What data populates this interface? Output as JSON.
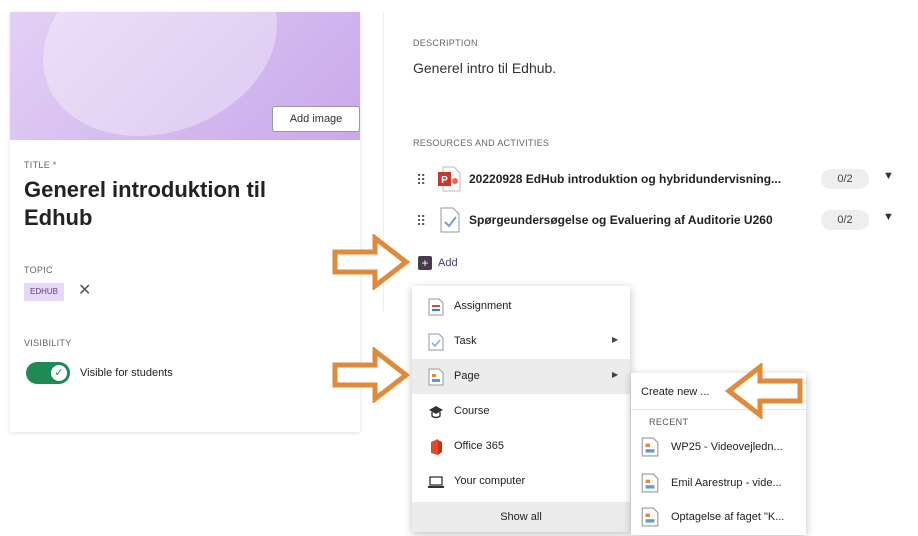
{
  "left": {
    "add_image_label": "Add image",
    "title_label": "TITLE *",
    "title_value": "Generel introduktion til Edhub",
    "topic_label": "TOPIC",
    "topic_chip": "EDHUB",
    "topic_remove_glyph": "✕",
    "visibility_label": "VISIBILITY",
    "visibility_text": "Visible for students",
    "visibility_on": true
  },
  "right": {
    "description_label": "DESCRIPTION",
    "description_text": "Generel intro til Edhub.",
    "resources_label": "RESOURCES AND ACTIVITIES",
    "resources": [
      {
        "name": "20220928 EdHub introduktion og hybridundervisning...",
        "badge": "0/2",
        "icon": "powerpoint-file-icon"
      },
      {
        "name": "Spørgeundersøgelse og Evaluering af Auditorie U260",
        "badge": "0/2",
        "icon": "survey-icon"
      }
    ],
    "add_label": "Add"
  },
  "menu": {
    "items": [
      {
        "label": "Assignment",
        "icon": "assignment-icon",
        "arrow": false
      },
      {
        "label": "Task",
        "icon": "task-icon",
        "arrow": true
      },
      {
        "label": "Page",
        "icon": "page-icon",
        "arrow": true,
        "hover": true
      },
      {
        "label": "Course",
        "icon": "course-icon",
        "arrow": false
      },
      {
        "label": "Office 365",
        "icon": "office365-icon",
        "arrow": false
      },
      {
        "label": "Your computer",
        "icon": "computer-icon",
        "arrow": false
      }
    ],
    "show_all": "Show all"
  },
  "submenu": {
    "create_new": "Create new ...",
    "recent_label": "RECENT",
    "recent": [
      {
        "label": "WP25 - Videovejledn..."
      },
      {
        "label": "Emil Aarestrup - vide..."
      },
      {
        "label": "Optagelse af faget \"K..."
      }
    ]
  },
  "colors": {
    "accent": "#5a3d86",
    "toggle_on": "#1f8a55",
    "arrow": "#e08a3c",
    "hero": "#d3b8ef"
  }
}
